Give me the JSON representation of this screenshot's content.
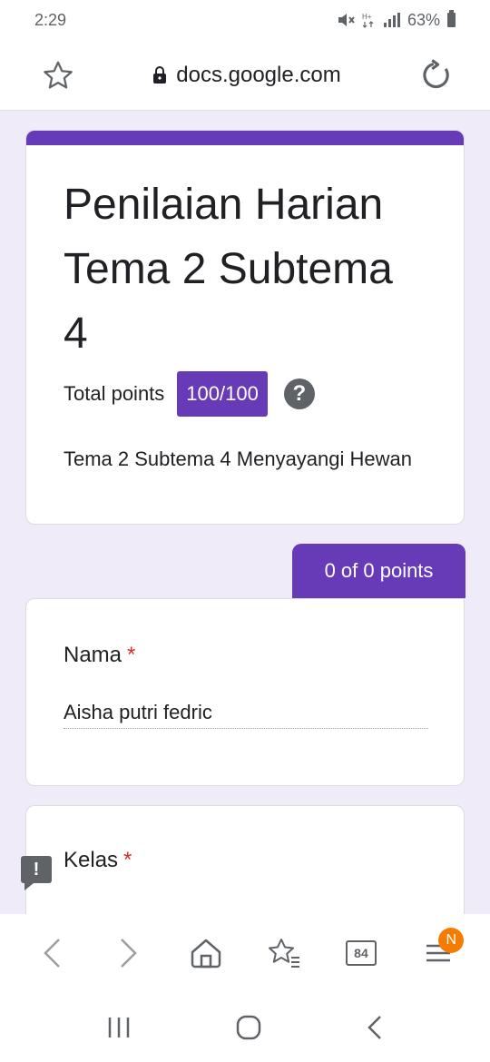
{
  "status_bar": {
    "time": "2:29",
    "battery": "63%"
  },
  "browser": {
    "url": "docs.google.com",
    "tab_count": "84",
    "notification_badge": "N"
  },
  "form": {
    "title": "Penilaian Harian Tema 2 Subtema 4",
    "total_points_label": "Total points",
    "total_points_value": "100/100",
    "description": "Tema 2 Subtema 4 Menyayangi Hewan",
    "score_tab": "0 of 0 points",
    "questions": [
      {
        "label": "Nama",
        "required": "*",
        "answer": "Aisha putri fedric"
      },
      {
        "label": "Kelas",
        "required": "*"
      }
    ]
  },
  "colors": {
    "accent": "#673ab7",
    "background": "#f0ebf8",
    "required": "#d93025",
    "badge": "#f57c00"
  }
}
